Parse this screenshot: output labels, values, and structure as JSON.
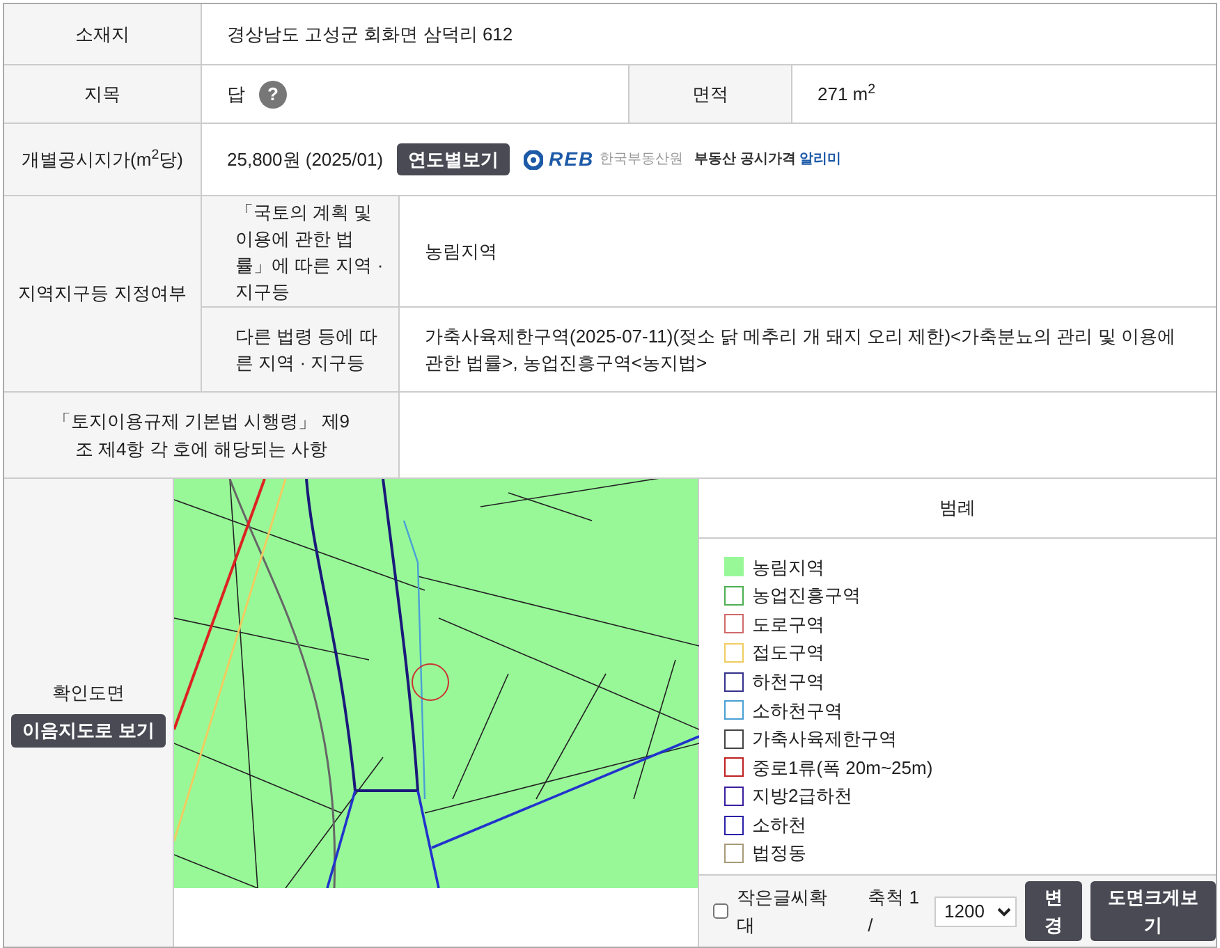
{
  "rows": [
    {
      "kind": "address",
      "label": "소재지",
      "value": "경상남도 고성군 회화면 삼덕리 612"
    },
    {
      "kind": "landcat",
      "label": "지목",
      "value": "답",
      "help": "?",
      "area_label": "면적",
      "area_value": "271 m$^{2}$"
    },
    {
      "kind": "price",
      "label": "개별공시지가(m$^{2}$당)",
      "value": "25,800원 (2025/01)",
      "button": "연도별보기",
      "logo": {
        "mark": "REB",
        "org": "한국부동산원",
        "service": "부동산 공시가격",
        "highlight": "알리미"
      }
    }
  ],
  "zoning": {
    "label": "지역지구등 지정여부",
    "items": [
      {
        "label": "「국토의 계획 및 이용에 관한 법률」에 따른 지역 · 지구등",
        "value": "농림지역"
      },
      {
        "label": "다른 법령 등에 따른 지역 · 지구등",
        "value": "가축사육제한구역(2025-07-11)(젖소 닭 메추리 개 돼지 오리 제한)<가축분뇨의 관리 및 이용에 관한 법률>, 농업진흥구역<농지법>"
      }
    ]
  },
  "decree": {
    "label": "「토지이용규제 기본법 시행령」 제9조 제4항 각 호에 해당되는 사항"
  },
  "map_section": {
    "label": "확인도면",
    "button": "이음지도로 보기",
    "legend": {
      "title": "범례",
      "items": [
        {
          "label": "농림지역",
          "kind": "filled",
          "color": "#98f898"
        },
        {
          "label": "농업진흥구역",
          "kind": "outline",
          "color": "#4caf50"
        },
        {
          "label": "도로구역",
          "kind": "outline",
          "color": "#d06a6a"
        },
        {
          "label": "접도구역",
          "kind": "outline",
          "color": "#f0cc60"
        },
        {
          "label": "하천구역",
          "kind": "outline",
          "color": "#35318c"
        },
        {
          "label": "소하천구역",
          "kind": "outline",
          "color": "#4a9fd5"
        },
        {
          "label": "가축사육제한구역",
          "kind": "outline",
          "color": "#444444"
        },
        {
          "label": "중로1류(폭 20m~25m)",
          "kind": "outline",
          "color": "#c02020"
        },
        {
          "label": "지방2급하천",
          "kind": "outline",
          "color": "#3a1fa0"
        },
        {
          "label": "소하천",
          "kind": "outline",
          "color": "#2a20a8"
        },
        {
          "label": "법정동",
          "kind": "outline",
          "color": "#a89a78"
        }
      ]
    },
    "controls": {
      "enlarge_label": "작은글씨확대",
      "enlarge_checked": false,
      "scale_label": "축척 1 /",
      "scale_value": "1200",
      "apply_button": "변경",
      "big_button": "도면크게보기"
    }
  }
}
